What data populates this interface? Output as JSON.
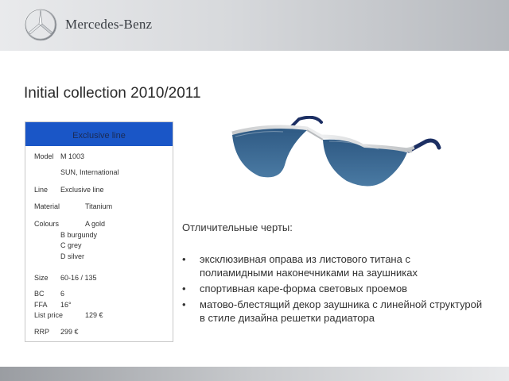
{
  "header": {
    "brand": "Mercedes-Benz"
  },
  "title": "Initial collection 2010/2011",
  "spec": {
    "heading": "Exclusive line",
    "model_label": "Model",
    "model_value": "M 1003",
    "model_sub": "SUN, International",
    "line_label": "Line",
    "line_value": "Exclusive line",
    "material_label": "Material",
    "material_value": "Titanium",
    "colours_label": "Colours",
    "colours": [
      "A  gold",
      "B  burgundy",
      "C  grey",
      "D  silver"
    ],
    "size_label": "Size",
    "size_value": "60-16 / 135",
    "bc_label": "BC",
    "bc_value": "6",
    "ffa_label": "FFA",
    "ffa_value": "16°",
    "list_price_label": "List price",
    "list_price_value": "129 €",
    "rrp_label": "RRP",
    "rrp_value": "299 €"
  },
  "features": {
    "title": "Отличительные черты:",
    "items": [
      "эксклюзивная оправа из листового титана с полиамидными наконечниками на заушниках",
      "спортивная каре-форма световых проемов",
      "матово-блестящий декор заушника с линейной структурой в стиле дизайна решетки радиатора"
    ]
  },
  "colors": {
    "accent_blue": "#1a56c7",
    "lens": "#3d6a93",
    "temple_tip": "#1c2f63"
  },
  "icons": {
    "logo": "mercedes-star-icon",
    "product": "sunglasses-image"
  }
}
